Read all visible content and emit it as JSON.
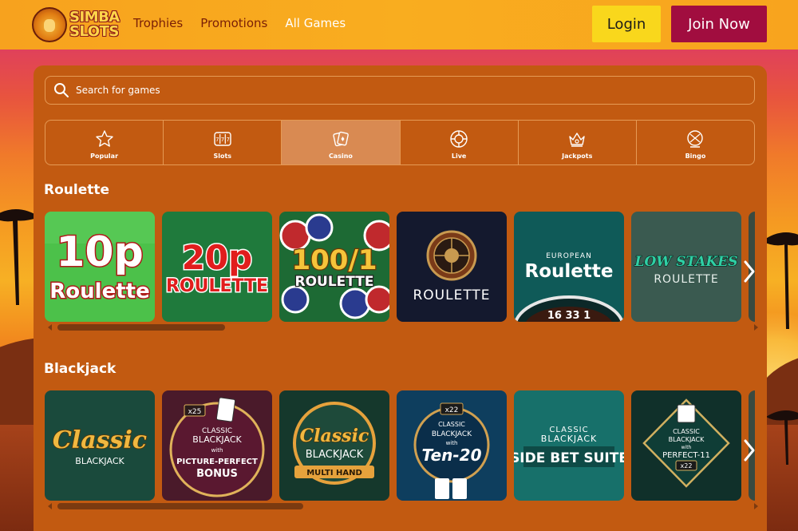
{
  "brand": {
    "logo_line1": "SIMBA",
    "logo_line2": "SLOTS"
  },
  "nav": [
    {
      "label": "Trophies",
      "active": false
    },
    {
      "label": "Promotions",
      "active": false
    },
    {
      "label": "All Games",
      "active": true
    }
  ],
  "auth": {
    "login_label": "Login",
    "join_label": "Join Now"
  },
  "search": {
    "placeholder": "Search for games",
    "value": ""
  },
  "categories": [
    {
      "label": "Popular",
      "icon": "star-icon",
      "active": false
    },
    {
      "label": "Slots",
      "icon": "slot-machine-icon",
      "active": false
    },
    {
      "label": "Casino",
      "icon": "cards-icon",
      "active": true
    },
    {
      "label": "Live",
      "icon": "chip-icon",
      "active": false
    },
    {
      "label": "Jackpots",
      "icon": "crown-icon",
      "active": false
    },
    {
      "label": "Bingo",
      "icon": "bingo-ball-icon",
      "active": false
    }
  ],
  "sections": [
    {
      "title": "Roulette",
      "games": [
        {
          "line1": "10p",
          "line2": "Roulette"
        },
        {
          "line1": "20p",
          "line2": "ROULETTE"
        },
        {
          "line1": "100/1",
          "line2": "ROULETTE"
        },
        {
          "line1": "",
          "line2": "ROULETTE"
        },
        {
          "line1": "EUROPEAN",
          "line2": "Roulette",
          "line3": "16 33 1"
        },
        {
          "line1": "LOW STAKES",
          "line2": "ROULETTE"
        }
      ]
    },
    {
      "title": "Blackjack",
      "games": [
        {
          "line1": "Classic",
          "line2": "BLACKJACK"
        },
        {
          "badge": "x25",
          "line1": "CLASSIC",
          "line2": "BLACKJACK",
          "line3": "with",
          "line4": "PICTURE-PERFECT",
          "line5": "BONUS"
        },
        {
          "line1": "Classic",
          "line2": "BLACKJACK",
          "line3": "MULTI HAND"
        },
        {
          "badge": "x22",
          "line1": "CLASSIC",
          "line2": "BLACKJACK",
          "line3": "with",
          "line4": "Ten-20"
        },
        {
          "line1": "CLASSIC",
          "line2": "BLACKJACK",
          "line3": "SIDE BET SUITE"
        },
        {
          "line1": "CLASSIC",
          "line2": "BLACKJACK",
          "line3": "with",
          "line4": "PERFECT-11",
          "badge": "x22"
        }
      ]
    }
  ],
  "colors": {
    "header": "#f9ad1f",
    "panel": "#c25a11",
    "login": "#f9d71c",
    "join": "#a10d3f"
  }
}
